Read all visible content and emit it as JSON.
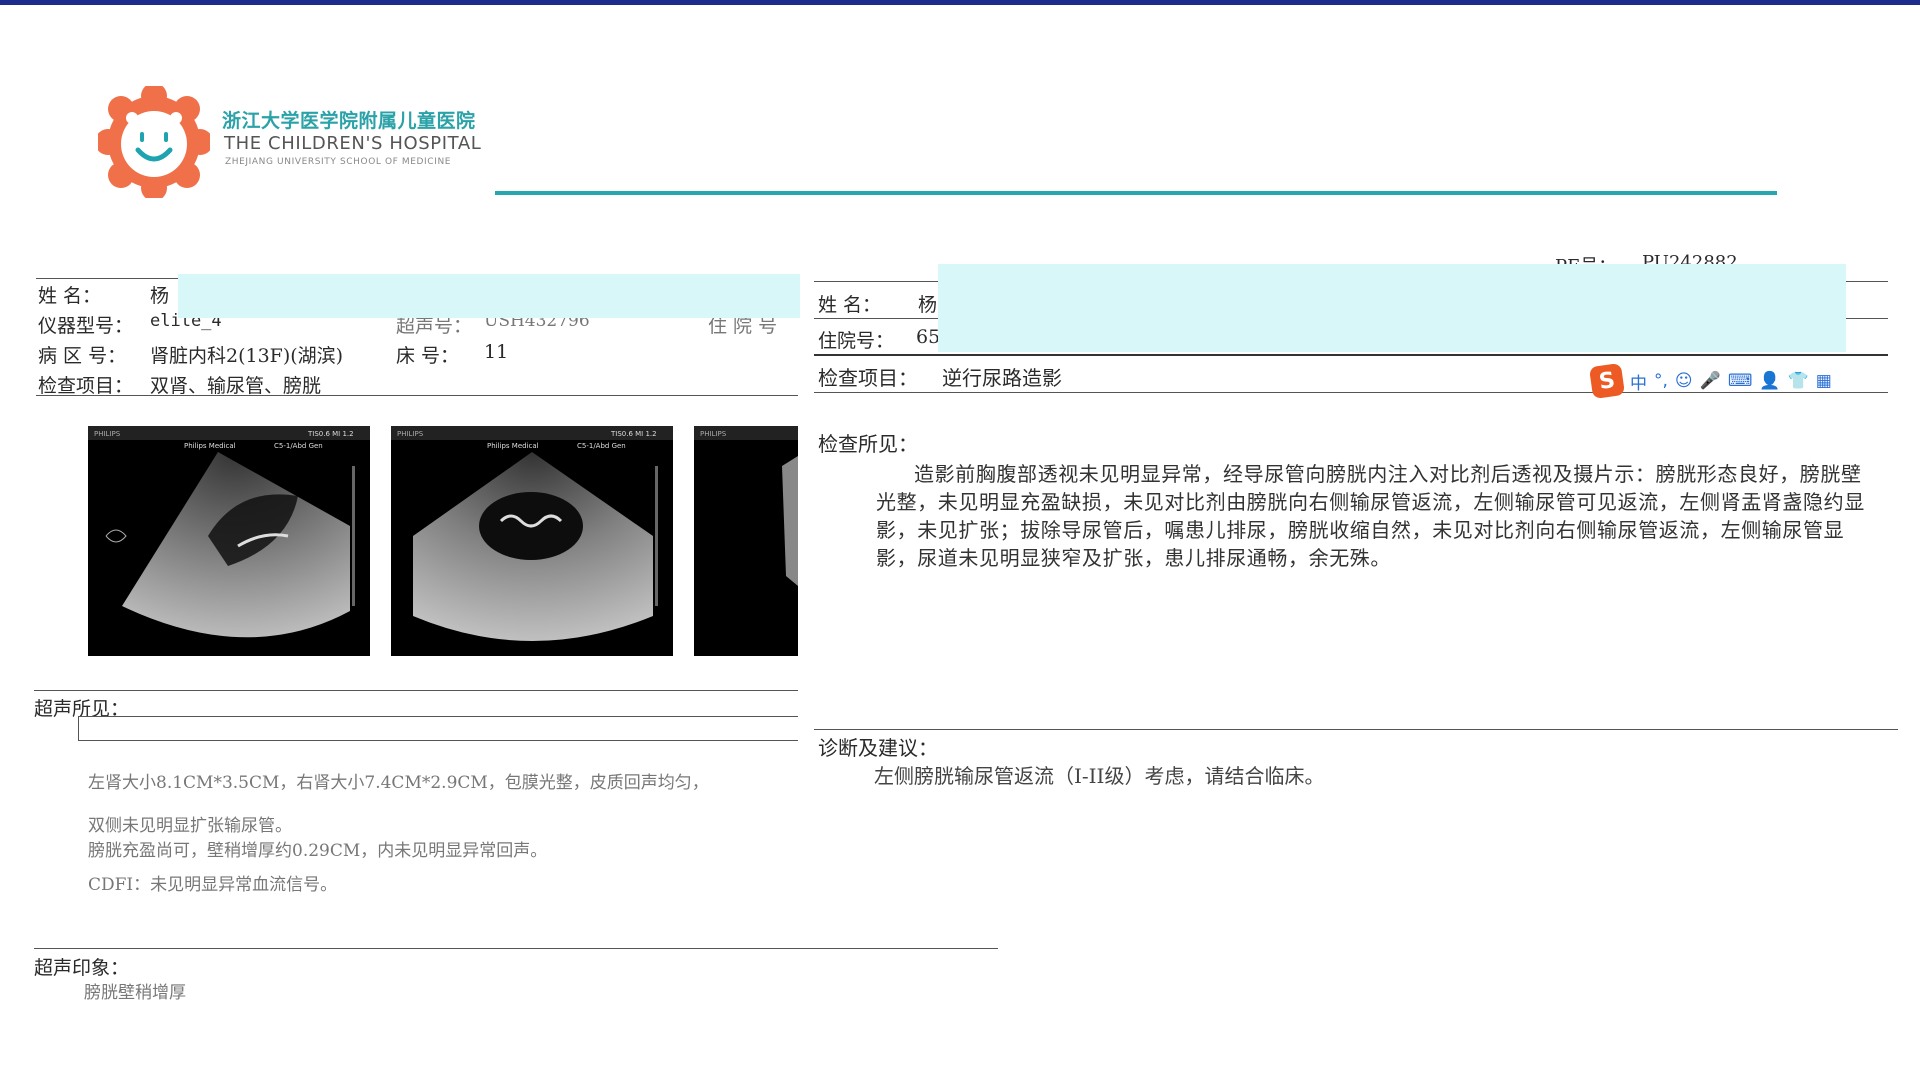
{
  "colors": {
    "topbar": "#1d2c8c",
    "brand_teal": "#27a7ad",
    "logo_orange": "#f0704a",
    "redaction": "#d8f7f8"
  },
  "header": {
    "hospital_cn": "浙江大学医学院附属儿童医院",
    "hospital_en": "THE CHILDREN'S HOSPITAL",
    "hospital_en_sub": "ZHEJIANG UNIVERSITY SCHOOL OF MEDICINE",
    "logo_icon": "smiling-lion-logo-icon"
  },
  "left_report": {
    "name_label": "姓    名：",
    "name_value": "杨",
    "device_label": "仪器型号：",
    "device_value": "elite_4",
    "us_no_label": "超声号：",
    "us_no_value": "USH432796",
    "inpatient_label_partial": "住 院 号",
    "ward_label": "病 区 号：",
    "ward_value": "肾脏内科2(13F)(湖滨)",
    "bed_label": "床    号：",
    "bed_value": "11",
    "exam_label": "检查项目：",
    "exam_value": "双肾、输尿管、膀胱",
    "images": [
      {
        "brand": "PHILIPS",
        "header": "Philips Medical",
        "probe": "C5-1/Abd Gen",
        "ti": "TIS0.6  MI 1.2"
      },
      {
        "brand": "PHILIPS",
        "header": "Philips Medical",
        "probe": "C5-1/Abd Gen",
        "ti": "TIS0.6  MI 1.2"
      },
      {
        "brand": "PHILIPS",
        "header": "",
        "probe": "",
        "ti": ""
      }
    ],
    "findings_title": "超声所见：",
    "findings": [
      "左肾大小8.1CM*3.5CM，右肾大小7.4CM*2.9CM，包膜光整，皮质回声均匀，",
      "双侧未见明显扩张输尿管。",
      "膀胱充盈尚可，壁稍增厚约0.29CM，内未见明显异常回声。",
      "CDFI：未见明显异常血流信号。"
    ],
    "impression_title": "超声印象：",
    "impression": "膀胱壁稍增厚"
  },
  "right_report": {
    "pe_label": "PE号：",
    "pe_value": "PU242882",
    "name_label": "姓    名：",
    "name_value": "杨",
    "inpatient_label": "住院号：",
    "inpatient_value": "65",
    "exam_label": "检查项目：",
    "exam_value": "逆行尿路造影",
    "findings_title": "检查所见：",
    "findings": "造影前胸腹部透视未见明显异常，经导尿管向膀胱内注入对比剂后透视及摄片示：膀胱形态良好，膀胱壁光整，未见明显充盈缺损，未见对比剂由膀胱向右侧输尿管返流，左侧输尿管可见返流，左侧肾盂肾盏隐约显影，未见扩张；拔除导尿管后，嘱患儿排尿，膀胱收缩自然，未见对比剂向右侧输尿管返流，左侧输尿管显影，尿道未见明显狭窄及扩张，患儿排尿通畅，余无殊。",
    "diagnosis_title": "诊断及建议：",
    "diagnosis": "左侧膀胱输尿管返流（I-II级）考虑，请结合临床。"
  },
  "ime_toolbar": {
    "logo": "S",
    "items": [
      "中",
      "°,",
      "☺",
      "🎤",
      "⌨",
      "👤",
      "👕",
      "▦"
    ]
  }
}
